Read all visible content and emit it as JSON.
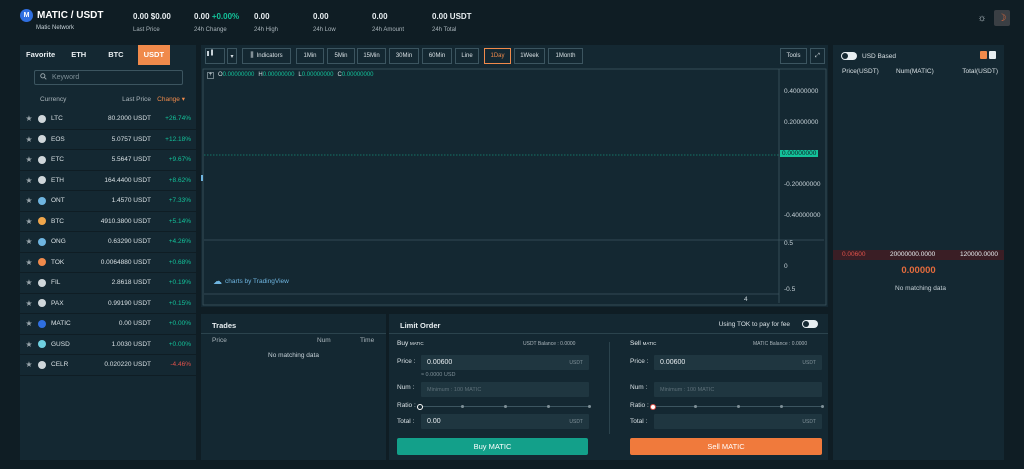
{
  "header": {
    "pair": "MATIC / USDT",
    "network": "Matic Network",
    "stats": [
      {
        "value": "0.00 $0.00",
        "label": "Last Price"
      },
      {
        "value": "0.00",
        "change": "+0.00%",
        "label": "24h Change"
      },
      {
        "value": "0.00",
        "label": "24h High"
      },
      {
        "value": "0.00",
        "label": "24h Low"
      },
      {
        "value": "0.00",
        "label": "24h Amount"
      },
      {
        "value": "0.00 USDT",
        "label": "24h Total"
      }
    ],
    "icons": [
      "sun-icon",
      "moon-icon"
    ]
  },
  "market": {
    "tabs": [
      "Favorite",
      "ETH",
      "BTC",
      "USDT"
    ],
    "active_tab": "USDT",
    "search_placeholder": "Keyword",
    "columns": {
      "currency": "Currency",
      "last_price": "Last Price",
      "change": "Change"
    },
    "rows": [
      {
        "sym": "LTC",
        "price": "80.2000 USDT",
        "chg": "+26.74%",
        "dir": "pos"
      },
      {
        "sym": "EOS",
        "price": "5.0757 USDT",
        "chg": "+12.18%",
        "dir": "pos"
      },
      {
        "sym": "ETC",
        "price": "5.5647 USDT",
        "chg": "+9.67%",
        "dir": "pos"
      },
      {
        "sym": "ETH",
        "price": "164.4400 USDT",
        "chg": "+8.62%",
        "dir": "pos"
      },
      {
        "sym": "ONT",
        "price": "1.4570 USDT",
        "chg": "+7.33%",
        "dir": "pos"
      },
      {
        "sym": "BTC",
        "price": "4910.3800 USDT",
        "chg": "+5.14%",
        "dir": "pos"
      },
      {
        "sym": "ONG",
        "price": "0.63290 USDT",
        "chg": "+4.26%",
        "dir": "pos"
      },
      {
        "sym": "TOK",
        "price": "0.0064880 USDT",
        "chg": "+0.68%",
        "dir": "pos"
      },
      {
        "sym": "FIL",
        "price": "2.8618 USDT",
        "chg": "+0.19%",
        "dir": "pos"
      },
      {
        "sym": "PAX",
        "price": "0.99190 USDT",
        "chg": "+0.15%",
        "dir": "pos"
      },
      {
        "sym": "MATIC",
        "price": "0.00 USDT",
        "chg": "+0.00%",
        "dir": "pos"
      },
      {
        "sym": "GUSD",
        "price": "1.0030 USDT",
        "chg": "+0.00%",
        "dir": "pos"
      },
      {
        "sym": "CELR",
        "price": "0.020220 USDT",
        "chg": "-4.46%",
        "dir": "neg"
      }
    ]
  },
  "chart": {
    "toolbar": [
      "Indicators",
      "1Min",
      "5Min",
      "15Min",
      "30Min",
      "60Min",
      "Line",
      "1Day",
      "1Week",
      "1Month"
    ],
    "active_interval": "1Day",
    "tools_label": "Tools",
    "ohlc": {
      "O": "0.00000000",
      "H": "0.00000000",
      "L": "0.00000000",
      "C": "0.00000000"
    },
    "price_axis": [
      "0.40000000",
      "0.20000000",
      "0.00000000",
      "-0.20000000",
      "-0.40000000"
    ],
    "volume_axis": [
      "0.5",
      "0",
      "-0.5"
    ],
    "x_label": "4",
    "watermark": "charts by TradingView"
  },
  "trades": {
    "title": "Trades",
    "columns": [
      "Price",
      "Num",
      "Time"
    ],
    "empty": "No matching data"
  },
  "limit_order": {
    "title": "Limit Order",
    "tok_fee_label": "Using TOK to pay for fee",
    "buy": {
      "title": "Buy",
      "asset": "MATIC",
      "balance": "USDT Balance : 0.0000",
      "price_label": "Price :",
      "price": "0.00600",
      "price_unit": "USDT",
      "price_usd": "≈ 0.0000 USD",
      "num_label": "Num :",
      "num_placeholder": "Minimum : 100 MATIC",
      "ratio_label": "Ratio :",
      "total_label": "Total :",
      "total": "0.00",
      "total_unit": "USDT",
      "button": "Buy MATIC"
    },
    "sell": {
      "title": "Sell",
      "asset": "MATIC",
      "balance": "MATIC Balance : 0.0000",
      "price_label": "Price :",
      "price": "0.00600",
      "price_unit": "USDT",
      "num_label": "Num :",
      "num_placeholder": "Minimum : 100 MATIC",
      "ratio_label": "Ratio :",
      "total_label": "Total :",
      "total_unit": "USDT",
      "button": "Sell MATIC"
    }
  },
  "orderbook": {
    "usd_based_label": "USD Based",
    "columns": [
      "Price(USDT)",
      "Num(MATIC)",
      "Total(USDT)"
    ],
    "ask": {
      "price": "0.00600",
      "num": "20000000.0000",
      "total": "120000.0000"
    },
    "last_price": "0.00000",
    "empty": "No matching data"
  },
  "colors": {
    "positive": "#13c29a",
    "negative": "#e0524b",
    "accent": "#f08a4b",
    "buy": "#13a08a",
    "sell": "#f07a3c"
  }
}
